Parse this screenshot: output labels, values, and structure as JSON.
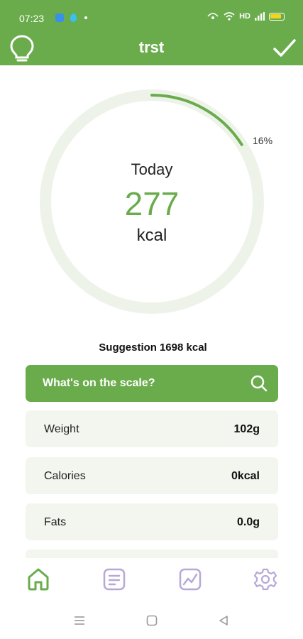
{
  "status_bar": {
    "time": "07:23",
    "hd": "HD"
  },
  "header": {
    "title": "trst",
    "left_icon": "lightbulb-icon",
    "right_icon": "checkmark-icon"
  },
  "ring": {
    "label": "Today",
    "value": "277",
    "unit": "kcal",
    "progress_text": "16%",
    "progress_fraction": 0.16
  },
  "suggestion": {
    "label": "Suggestion",
    "value": "1698 kcal"
  },
  "scale": {
    "prompt": "What's on the scale?",
    "icon": "search-icon"
  },
  "metrics": [
    {
      "label": "Weight",
      "value": "102g"
    },
    {
      "label": "Calories",
      "value": "0kcal"
    },
    {
      "label": "Fats",
      "value": "0.0g"
    }
  ],
  "bottom_nav": [
    {
      "name": "home",
      "icon": "home-icon",
      "active": true
    },
    {
      "name": "list",
      "icon": "list-icon",
      "active": false
    },
    {
      "name": "stats",
      "icon": "chart-icon",
      "active": false
    },
    {
      "name": "settings",
      "icon": "gear-icon",
      "active": false
    }
  ],
  "colors": {
    "brand_green": "#6aac4c",
    "ring_track": "#eef3ea",
    "row_bg": "#f2f6ef",
    "nav_inactive": "#b8a8d8"
  }
}
